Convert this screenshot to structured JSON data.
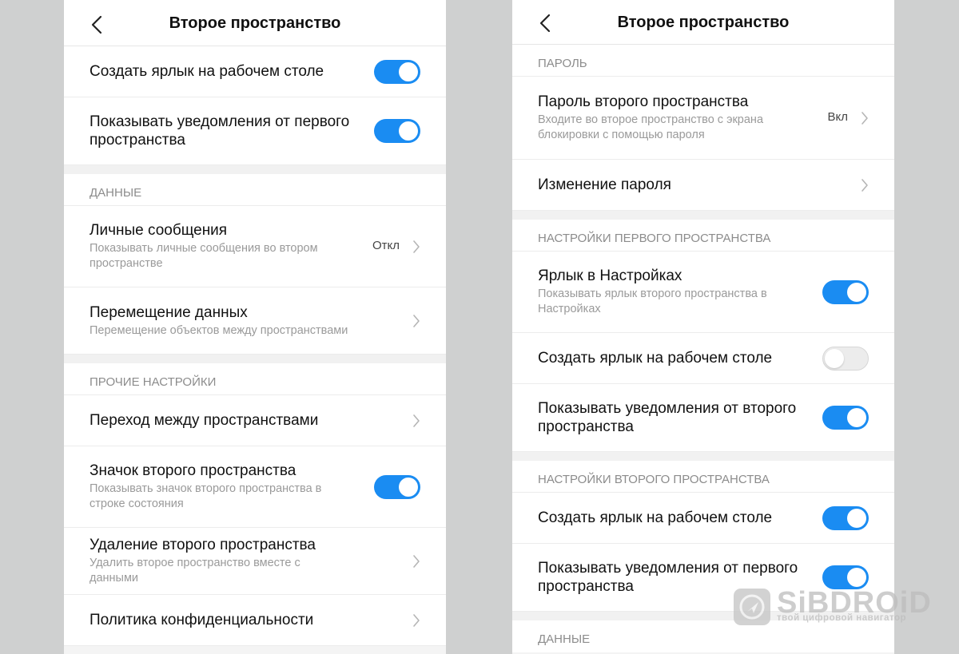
{
  "left": {
    "title": "Второе пространство",
    "rows_top": [
      {
        "title": "Создать ярлык на рабочем столе"
      },
      {
        "title": "Показывать уведомления от первого пространства"
      }
    ],
    "data_section": {
      "header": "ДАННЫЕ",
      "personal_messages": {
        "title": "Личные сообщения",
        "subtitle": "Показывать личные сообщения во втором пространстве",
        "value": "Откл"
      },
      "data_move": {
        "title": "Перемещение данных",
        "subtitle": "Перемещение объектов между пространствами"
      }
    },
    "other_section": {
      "header": "ПРОЧИЕ НАСТРОЙКИ",
      "switch_spaces": {
        "title": "Переход между пространствами"
      },
      "space_icon": {
        "title": "Значок второго пространства",
        "subtitle": "Показывать значок второго пространства в строке состояния"
      },
      "delete_space": {
        "title": "Удаление второго пространства",
        "subtitle": "Удалить второе пространство вместе с данными"
      },
      "privacy": {
        "title": "Политика конфиденциальности"
      }
    }
  },
  "right": {
    "title": "Второе пространство",
    "password_section": {
      "header": "ПАРОЛЬ",
      "space_password": {
        "title": "Пароль второго пространства",
        "subtitle": "Входите во второе пространство с экрана блокировки с помощью пароля",
        "value": "Вкл"
      },
      "change_password": {
        "title": "Изменение пароля"
      }
    },
    "first_space_section": {
      "header": "НАСТРОЙКИ ПЕРВОГО ПРОСТРАНСТВА",
      "settings_shortcut": {
        "title": "Ярлык в Настройках",
        "subtitle": "Показывать ярлык второго пространства в Настройках"
      },
      "desktop_shortcut": {
        "title": "Создать ярлык на рабочем столе"
      },
      "notifications": {
        "title": "Показывать уведомления от второго пространства"
      }
    },
    "second_space_section": {
      "header": "НАСТРОЙКИ ВТОРОГО ПРОСТРАНСТВА",
      "desktop_shortcut": {
        "title": "Создать ярлык на рабочем столе"
      },
      "notifications": {
        "title": "Показывать уведомления от первого пространства"
      }
    },
    "data_header": "ДАННЫЕ"
  },
  "watermark": {
    "name": "SiBDROiD",
    "tagline": "твой цифровой навигатор"
  },
  "colors": {
    "toggle_on": "#1a8cf2",
    "toggle_off": "#ececec"
  }
}
